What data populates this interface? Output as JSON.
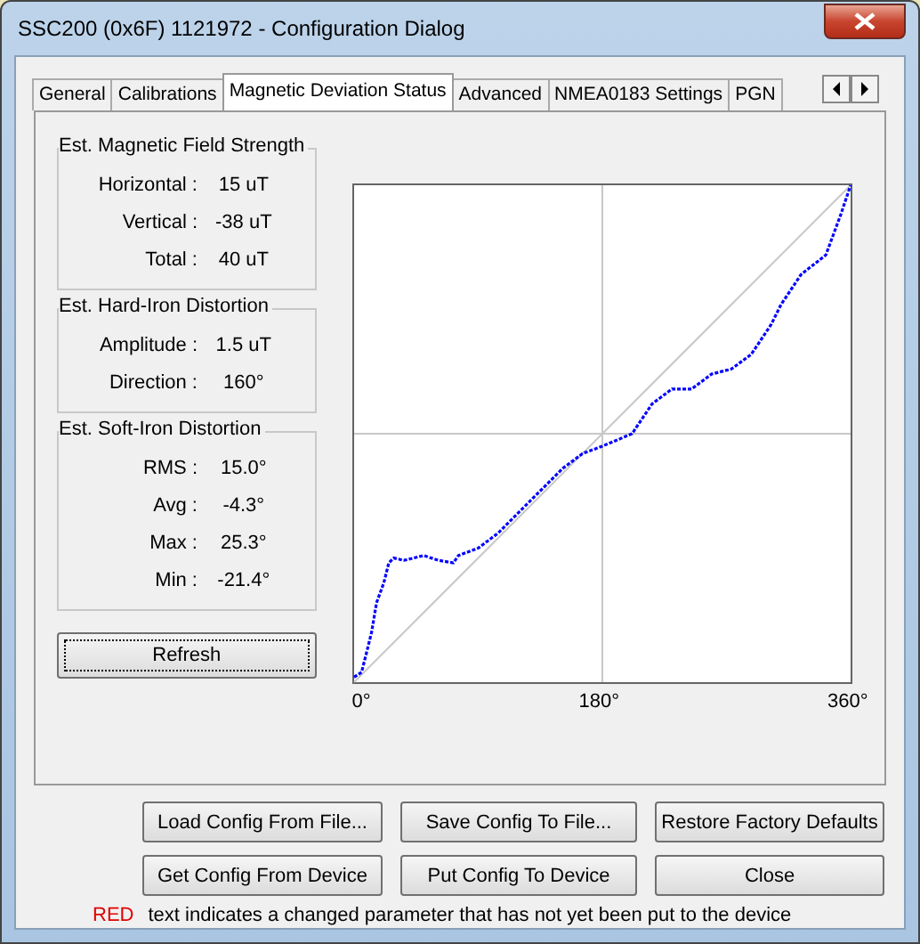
{
  "window": {
    "title": "SSC200 (0x6F) 1121972 - Configuration Dialog"
  },
  "tabs": [
    {
      "label": "General",
      "selected": false
    },
    {
      "label": "Calibrations",
      "selected": false
    },
    {
      "label": "Magnetic Deviation Status",
      "selected": true
    },
    {
      "label": "Advanced",
      "selected": false
    },
    {
      "label": "NMEA0183 Settings",
      "selected": false
    },
    {
      "label": "PGN",
      "selected": false
    }
  ],
  "groups": [
    {
      "title": "Est. Magnetic Field Strength",
      "rows": [
        {
          "label": "Horizontal :",
          "value": "15 uT"
        },
        {
          "label": "Vertical :",
          "value": "-38 uT"
        },
        {
          "label": "Total :",
          "value": "40 uT"
        }
      ]
    },
    {
      "title": "Est. Hard-Iron Distortion",
      "rows": [
        {
          "label": "Amplitude :",
          "value": "1.5 uT"
        },
        {
          "label": "Direction :",
          "value": "160°"
        }
      ]
    },
    {
      "title": "Est. Soft-Iron Distortion",
      "rows": [
        {
          "label": "RMS :",
          "value": "15.0°"
        },
        {
          "label": "Avg :",
          "value": "-4.3°"
        },
        {
          "label": "Max :",
          "value": "25.3°"
        },
        {
          "label": "Min :",
          "value": "-21.4°"
        }
      ]
    }
  ],
  "refresh_button": "Refresh",
  "deviation_plot": {
    "x_labels": [
      "0°",
      "180°",
      "360°"
    ]
  },
  "buttons": [
    [
      "Load Config From File...",
      "Save Config To File...",
      "Restore Factory Defaults"
    ],
    [
      "Get Config From Device",
      "Put Config To Device",
      "Close"
    ]
  ],
  "note": {
    "highlight": "RED",
    "text": "text indicates a changed parameter that has not yet been put to the device"
  }
}
